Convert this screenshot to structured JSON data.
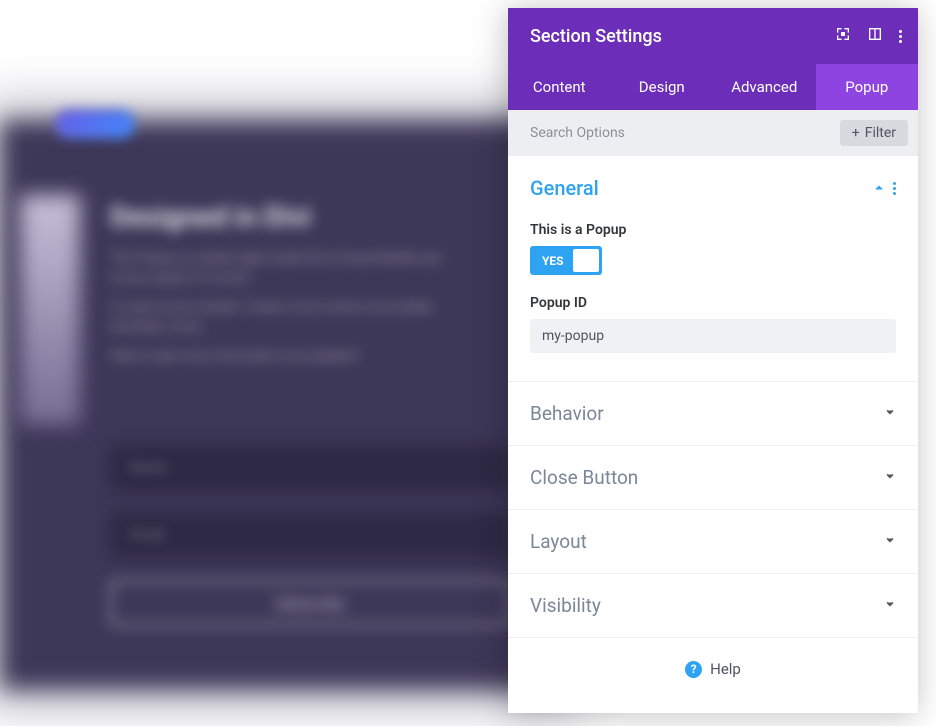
{
  "background": {
    "heading": "Designed in Divi",
    "para1": "This Popup is created right inside Divi's Visual Builder just as you expect it to work!",
    "para2": "It could not be simpler: Create a new section and enable the Mode. Done.",
    "para3": "Want to get more information and updates?",
    "field1": "Name",
    "field2": "Email",
    "button": "Subscribe"
  },
  "panel": {
    "title": "Section Settings",
    "tabs": {
      "content": "Content",
      "design": "Design",
      "advanced": "Advanced",
      "popup": "Popup"
    },
    "search": {
      "placeholder": "Search Options",
      "filter": "Filter"
    },
    "sections": {
      "general": {
        "title": "General",
        "is_popup": {
          "label": "This is a Popup",
          "toggle": "YES"
        },
        "popup_id": {
          "label": "Popup ID",
          "value": "my-popup"
        }
      },
      "behavior": "Behavior",
      "close_button": "Close Button",
      "layout": "Layout",
      "visibility": "Visibility"
    },
    "help": "Help"
  }
}
